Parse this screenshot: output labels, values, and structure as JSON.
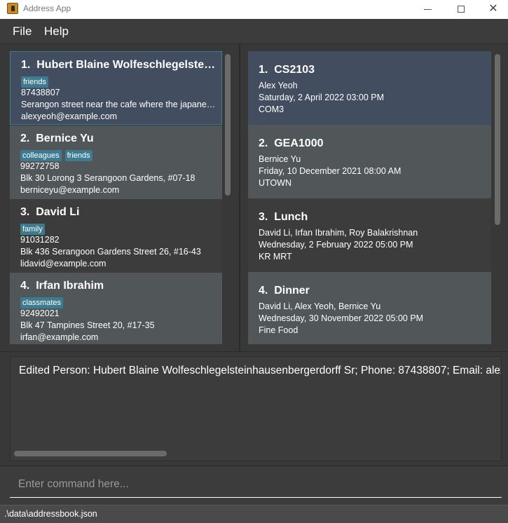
{
  "window": {
    "title": "Address App",
    "minimize_glyph": "—",
    "close_glyph": "✕"
  },
  "menu": {
    "file": "File",
    "help": "Help"
  },
  "persons": [
    {
      "index": "1.",
      "name": "Hubert Blaine Wolfeschlegelsteinhausenbergerdorff Sr",
      "tags": [
        "friends"
      ],
      "phone": "87438807",
      "address": "Serangon street near the cafe where the japanese people eat",
      "email": "alexyeoh@example.com",
      "selected": true
    },
    {
      "index": "2.",
      "name": "Bernice Yu",
      "tags": [
        "colleagues",
        "friends"
      ],
      "phone": "99272758",
      "address": "Blk 30 Lorong 3 Serangoon Gardens, #07-18",
      "email": "berniceyu@example.com"
    },
    {
      "index": "3.",
      "name": "David Li",
      "tags": [
        "family"
      ],
      "phone": "91031282",
      "address": "Blk 436 Serangoon Gardens Street 26, #16-43",
      "email": "lidavid@example.com"
    },
    {
      "index": "4.",
      "name": "Irfan Ibrahim",
      "tags": [
        "classmates"
      ],
      "phone": "92492021",
      "address": "Blk 47 Tampines Street 20, #17-35",
      "email": "irfan@example.com"
    }
  ],
  "events": [
    {
      "index": "1.",
      "name": "CS2103",
      "participants": "Alex Yeoh",
      "datetime": "Saturday, 2 April 2022 03:00 PM",
      "location": "COM3",
      "selected": true
    },
    {
      "index": "2.",
      "name": "GEA1000",
      "participants": "Bernice Yu",
      "datetime": "Friday, 10 December 2021 08:00 AM",
      "location": "UTOWN"
    },
    {
      "index": "3.",
      "name": "Lunch",
      "participants": "David Li, Irfan Ibrahim, Roy Balakrishnan",
      "datetime": "Wednesday, 2 February 2022 05:00 PM",
      "location": "KR MRT"
    },
    {
      "index": "4.",
      "name": "Dinner",
      "participants": "David Li, Alex Yeoh, Bernice Yu",
      "datetime": "Wednesday, 30 November 2022 05:00 PM",
      "location": "Fine Food"
    }
  ],
  "result": {
    "text": "Edited Person: Hubert Blaine Wolfeschlegelsteinhausenbergerdorff Sr; Phone: 87438807; Email: alexyeoh@example.com"
  },
  "command": {
    "placeholder": "Enter command here...",
    "value": ""
  },
  "status": {
    "path": ".\\data\\addressbook.json"
  },
  "colors": {
    "tag": "#3e7b91",
    "selected_card": "#424d5f",
    "light_card": "#515658",
    "dark_card": "#3c3c3c"
  }
}
